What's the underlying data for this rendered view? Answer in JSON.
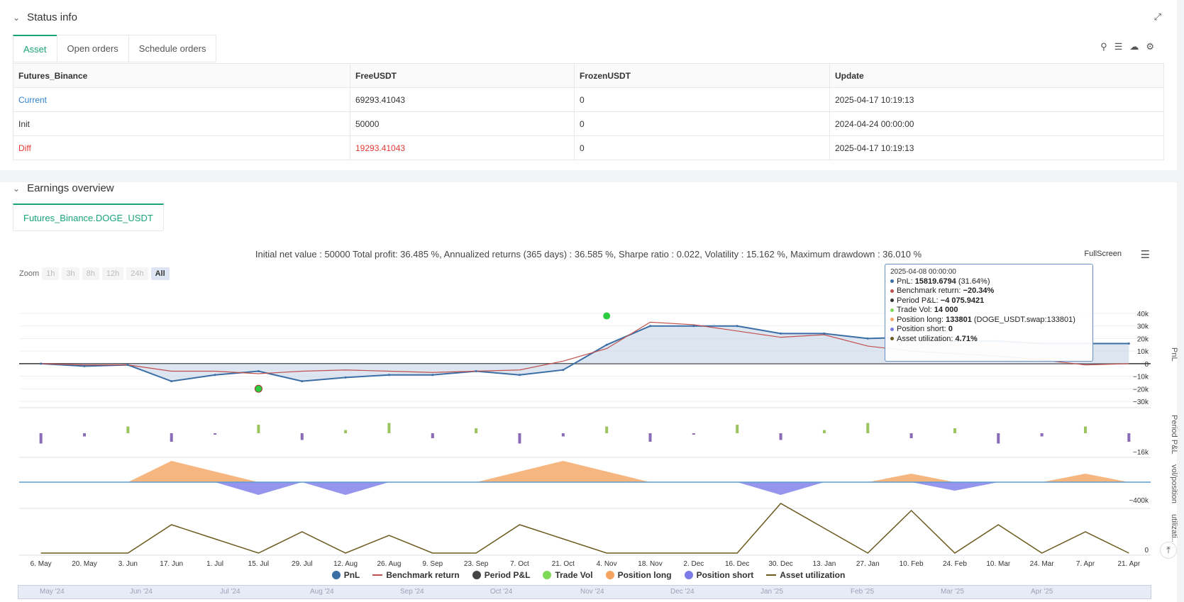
{
  "status_panel": {
    "title": "Status info",
    "tabs": [
      "Asset",
      "Open orders",
      "Schedule orders"
    ],
    "table": {
      "headers": [
        "Futures_Binance",
        "FreeUSDT",
        "FrozenUSDT",
        "Update"
      ],
      "rows": [
        [
          "Current",
          "69293.41043",
          "0",
          "2025-04-17 10:19:13"
        ],
        [
          "Init",
          "50000",
          "0",
          "2024-04-24 00:00:00"
        ],
        [
          "Diff",
          "19293.41043",
          "0",
          "2025-04-17 10:19:13"
        ]
      ]
    }
  },
  "earnings_panel": {
    "title": "Earnings overview",
    "tab": "Futures_Binance.DOGE_USDT",
    "summary": "Initial net value : 50000 Total profit: 36.485 %, Annualized returns (365 days) : 36.585 %, Sharpe ratio : 0.022, Volatility : 15.162 %, Maximum drawdown : 36.010 %",
    "fullscreen": "FullScreen",
    "zoom": {
      "label": "Zoom",
      "buttons": [
        "1h",
        "3h",
        "8h",
        "12h",
        "24h",
        "All"
      ],
      "active": "All"
    }
  },
  "tooltip": {
    "date": "2025-04-08 00:00:00",
    "rows": [
      {
        "label": "PnL: ",
        "value": "15819.6794",
        "extra": " (31.64%)",
        "color": "#3b6ea5"
      },
      {
        "label": "Benchmark return: ",
        "value": "−20.34%",
        "extra": "",
        "color": "#c0504d"
      },
      {
        "label": "Period P&L: ",
        "value": "−4 075.9421",
        "extra": "",
        "color": "#333333"
      },
      {
        "label": "Trade Vol: ",
        "value": "14 000",
        "extra": "",
        "color": "#7ed957"
      },
      {
        "label": "Position long: ",
        "value": "133801",
        "extra": " (DOGE_USDT.swap:133801)",
        "color": "#f4a460"
      },
      {
        "label": "Position short: ",
        "value": "0",
        "extra": "",
        "color": "#7b7bea"
      },
      {
        "label": "Asset utilization: ",
        "value": "4.71%",
        "extra": "",
        "color": "#6b5a1e"
      }
    ]
  },
  "chart_data": {
    "type": "line",
    "x_ticks": [
      "6. May",
      "20. May",
      "3. Jun",
      "17. Jun",
      "1. Jul",
      "15. Jul",
      "29. Jul",
      "12. Aug",
      "26. Aug",
      "9. Sep",
      "23. Sep",
      "7. Oct",
      "21. Oct",
      "4. Nov",
      "18. Nov",
      "2. Dec",
      "16. Dec",
      "30. Dec",
      "13. Jan",
      "27. Jan",
      "10. Feb",
      "24. Feb",
      "10. Mar",
      "24. Mar",
      "7. Apr",
      "21. Apr"
    ],
    "pnl_axis": {
      "ticks": [
        "40k",
        "30k",
        "20k",
        "10k",
        "0",
        "−10k",
        "−20k",
        "−30k"
      ],
      "label": "PnL"
    },
    "period_axis": {
      "ticks": [
        "−16k"
      ],
      "label": "Period P&L"
    },
    "position_axis": {
      "ticks": [
        "−400k"
      ],
      "label": "vol/position"
    },
    "util_axis": {
      "ticks": [
        "0"
      ],
      "label": "utilizati..."
    },
    "series": [
      {
        "name": "PnL",
        "values": [
          0,
          -2,
          -1,
          -14,
          -9,
          -6,
          -14,
          -11,
          -9,
          -9,
          -6,
          -9,
          -5,
          15,
          30,
          30,
          30,
          24,
          24,
          20,
          21,
          18,
          18,
          16,
          16,
          16
        ]
      },
      {
        "name": "Benchmark return",
        "values": [
          0,
          -1,
          -1,
          -6,
          -6,
          -8,
          -6,
          -5,
          -6,
          -7,
          -6,
          -5,
          2,
          12,
          33,
          31,
          26,
          21,
          23,
          14,
          10,
          8,
          6,
          3,
          -1,
          0
        ]
      },
      {
        "name": "Position long",
        "values": [
          0,
          0,
          0,
          100,
          50,
          0,
          0,
          0,
          0,
          0,
          0,
          50,
          100,
          50,
          0,
          0,
          0,
          0,
          0,
          0,
          40,
          0,
          0,
          0,
          40,
          0
        ]
      },
      {
        "name": "Position short",
        "values": [
          0,
          0,
          0,
          0,
          0,
          -60,
          0,
          -60,
          0,
          0,
          0,
          0,
          0,
          0,
          0,
          0,
          0,
          -60,
          0,
          0,
          0,
          -40,
          0,
          0,
          0,
          0
        ]
      },
      {
        "name": "Asset utilization",
        "values": [
          0,
          0,
          0,
          40,
          20,
          0,
          30,
          0,
          25,
          0,
          0,
          40,
          20,
          0,
          0,
          0,
          0,
          70,
          35,
          0,
          60,
          0,
          40,
          0,
          30,
          0
        ]
      }
    ],
    "legend": [
      "PnL",
      "Benchmark return",
      "Period P&L",
      "Trade Vol",
      "Position long",
      "Position short",
      "Asset utilization"
    ],
    "navigator": [
      "May '24",
      "Jun '24",
      "Jul '24",
      "Aug '24",
      "Sep '24",
      "Oct '24",
      "Nov '24",
      "Dec '24",
      "Jan '25",
      "Feb '25",
      "Mar '25",
      "Apr '25"
    ]
  },
  "colors": {
    "accent": "#1aa37a",
    "pnl": "#3b6ea5",
    "bench": "#c0504d",
    "long": "#f4a460",
    "short": "#7b7bea",
    "util": "#6b5a1e"
  }
}
